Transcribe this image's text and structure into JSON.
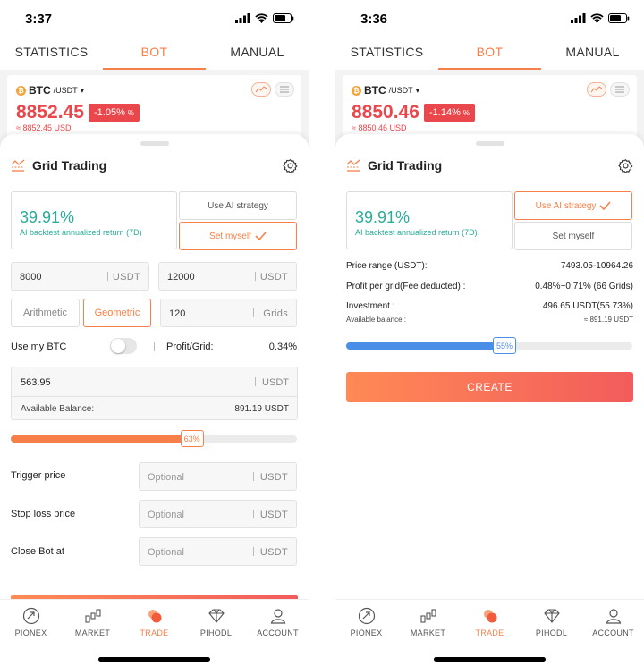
{
  "tabs": [
    "STATISTICS",
    "BOT",
    "MANUAL"
  ],
  "nav": [
    "PIONEX",
    "MARKET",
    "TRADE",
    "PIHODL",
    "ACCOUNT"
  ],
  "colors": {
    "accent": "#f7804a",
    "price_red": "#e9474b",
    "teal": "#2bab9a",
    "slider_blue": "#4a8ee8"
  },
  "icons": [
    "signal-icon",
    "wifi-icon",
    "battery-icon",
    "grid-trading-icon",
    "gear-icon",
    "chart-icon",
    "list-icon",
    "check-icon",
    "pionex-icon",
    "market-icon",
    "trade-icon",
    "pihodl-icon",
    "account-icon"
  ],
  "left": {
    "time": "3:37",
    "pair": {
      "base": "BTC",
      "quote": "/USDT",
      "caret": "▾",
      "coin_glyph": "₿"
    },
    "price": "8852.45",
    "change": "-1.05%",
    "usd_price": "≈ 8852.45 USD",
    "panel_title": "Grid Trading",
    "strategy": {
      "return": "39.91%",
      "subtitle": "AI backtest annualized return (7D)",
      "ai_label": "Use AI strategy",
      "self_label": "Set myself",
      "selected": "self"
    },
    "lower_price": "8000",
    "upper_price": "12000",
    "unit_usdt": "USDT",
    "mode_arithmetic": "Arithmetic",
    "mode_geometric": "Geometric",
    "grids": "120",
    "grids_unit": "Grids",
    "use_btc_label": "Use my BTC",
    "profit_grid_label": "Profit/Grid:",
    "profit_grid_value": "0.34%",
    "investment": "563.95",
    "available_label": "Available Balance:",
    "available_value": "891.19 USDT",
    "slider_percent": 63,
    "slider_label": "63%",
    "trigger_label": "Trigger price",
    "stop_loss_label": "Stop loss price",
    "close_bot_label": "Close Bot at",
    "optional_placeholder": "Optional"
  },
  "right": {
    "time": "3:36",
    "pair": {
      "base": "BTC",
      "quote": "/USDT",
      "caret": "▾",
      "coin_glyph": "₿"
    },
    "price": "8850.46",
    "change": "-1.14%",
    "usd_price": "≈ 8850.46 USD",
    "panel_title": "Grid Trading",
    "strategy": {
      "return": "39.91%",
      "subtitle": "AI backtest annualized return (7D)",
      "ai_label": "Use AI strategy",
      "self_label": "Set myself",
      "selected": "ai"
    },
    "price_range_label": "Price range (USDT):",
    "price_range_value": "7493.05-10964.26",
    "profit_label": "Profit per grid(Fee deducted) :",
    "profit_value": "0.48%~0.71% (66 Grids)",
    "investment_label": "Investment :",
    "investment_value": "496.65 USDT(55.73%)",
    "balance_label": "Available balance :",
    "balance_value": "≈ 891.19 USDT",
    "slider_percent": 55,
    "slider_label": "55%",
    "create_label": "CREATE"
  }
}
